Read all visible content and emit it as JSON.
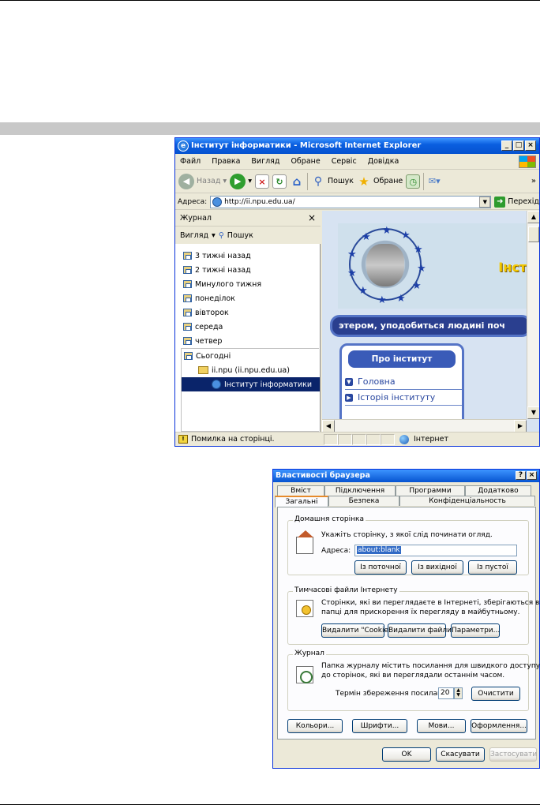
{
  "ie": {
    "title": "Інститут інформатики - Microsoft Internet Explorer",
    "menu": [
      "Файл",
      "Правка",
      "Вигляд",
      "Обране",
      "Сервіс",
      "Довідка"
    ],
    "toolbar": {
      "back": "Назад",
      "search": "Пошук",
      "favorites": "Обране",
      "more": "»"
    },
    "address": {
      "label": "Адреса:",
      "value": "http://ii.npu.edu.ua/",
      "go": "Перехід"
    },
    "history": {
      "title": "Журнал",
      "view": "Вигляд",
      "search": "Пошук",
      "items": [
        "3 тижні назад",
        "2 тижні назад",
        "Минулого тижня",
        "понеділок",
        "вівторок",
        "середа",
        "четвер",
        "Сьогодні"
      ],
      "site": "ii.npu (ii.npu.edu.ua)",
      "page": "Інститут інформатики"
    },
    "content": {
      "banner": "этером, уподобиться людині поч",
      "inst": "Інст",
      "about_title": "Про інститут",
      "nav": [
        "Головна",
        "Історія інституту"
      ]
    },
    "status": {
      "text": "Помилка на сторінці.",
      "zone": "Інтернет"
    }
  },
  "dialog": {
    "title": "Властивості браузера",
    "tabs_back": [
      "Вміст",
      "Підключення",
      "Программи",
      "Додатково"
    ],
    "tabs_front": [
      "Загальні",
      "Безпека",
      "Конфіденціальность"
    ],
    "home": {
      "label": "Домашня сторінка",
      "text": "Укажіть сторінку, з якої слід починати огляд.",
      "addr_label": "Адреса:",
      "addr_value": "about:blank",
      "btn_current": "Із поточної",
      "btn_default": "Із вихідної",
      "btn_blank": "Із пустої"
    },
    "temp": {
      "label": "Тимчасові файли Інтернету",
      "text1": "Сторінки, які ви переглядаєте в Інтернеті, зберігаються в",
      "text2": "папці для прискорення їх перегляду в майбутньому.",
      "btn_cookie": "Видалити \"Cookie\"...",
      "btn_files": "Видалити файли...",
      "btn_params": "Параметри..."
    },
    "journal": {
      "label": "Журнал",
      "text1": "Папка журналу містить посилання для швидкого доступу",
      "text2": "до сторінок, які ви переглядали останнім часом.",
      "days_label": "Термін збереження посилань:",
      "days": "20",
      "btn_clear": "Очистити"
    },
    "bottom": {
      "colors": "Кольори...",
      "fonts": "Шрифти...",
      "langs": "Мови...",
      "design": "Оформлення..."
    },
    "ok": "OK",
    "cancel": "Скасувати",
    "apply": "Застосувати"
  }
}
